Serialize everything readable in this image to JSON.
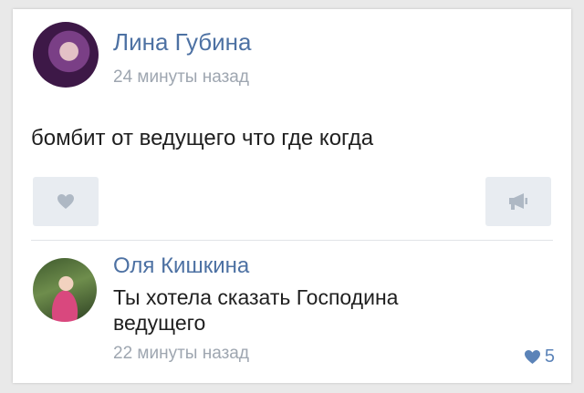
{
  "post": {
    "author": "Лина Губина",
    "timestamp": "24 минуты назад",
    "text": "бомбит от ведущего что где когда",
    "avatar_icon": "user-avatar-photo",
    "like_icon": "heart-icon",
    "share_icon": "megaphone-icon"
  },
  "comment": {
    "author": "Оля Кишкина",
    "text": "Ты хотела сказать Господина ведущего",
    "timestamp": "22 минуты назад",
    "likes": "5",
    "avatar_icon": "user-avatar-photo",
    "like_icon": "heart-icon"
  },
  "colors": {
    "accent": "#4d71a3",
    "muted": "#9ea6b0",
    "button_bg": "#e8ecf1",
    "like_blue": "#5b83b8"
  }
}
